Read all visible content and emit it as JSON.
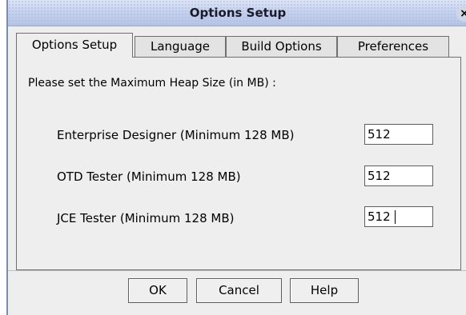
{
  "window": {
    "title": "Options Setup",
    "close_glyph": "×"
  },
  "tabs": [
    {
      "label": "Options Setup",
      "active": true
    },
    {
      "label": "Language",
      "active": false
    },
    {
      "label": "Build Options",
      "active": false
    },
    {
      "label": "Preferences",
      "active": false
    }
  ],
  "panel": {
    "prompt": "Please set the Maximum Heap Size (in MB) :",
    "fields": [
      {
        "label": "Enterprise Designer (Minimum 128 MB)",
        "value": "512"
      },
      {
        "label": "OTD Tester (Minimum 128 MB)",
        "value": "512"
      },
      {
        "label": "JCE Tester (Minimum 128 MB)",
        "value": "512"
      }
    ]
  },
  "buttons": {
    "ok": "OK",
    "cancel": "Cancel",
    "help": "Help"
  }
}
